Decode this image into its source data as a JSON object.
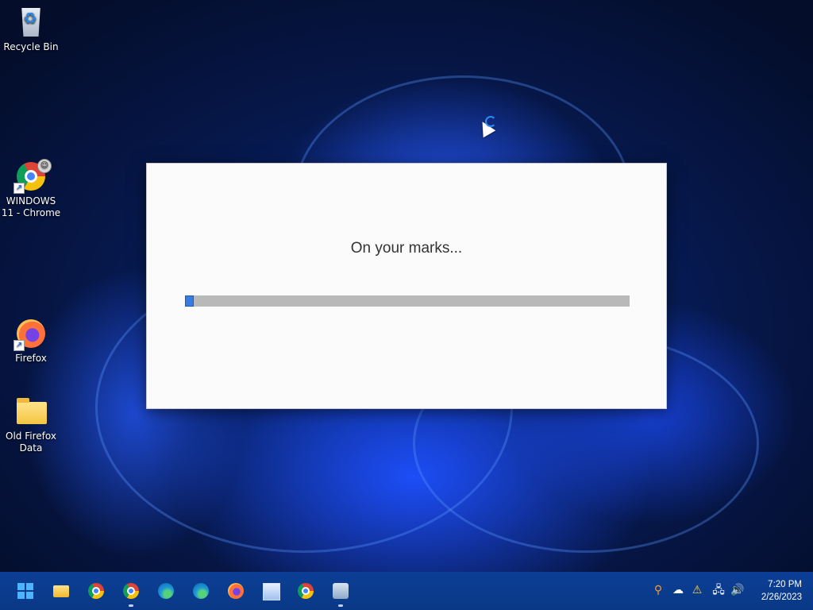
{
  "desktop": {
    "icons": [
      {
        "label": "Recycle Bin",
        "icon": "recycle-bin-icon"
      },
      {
        "label": "WINDOWS 11 - Chrome",
        "icon": "chrome-icon"
      },
      {
        "label": "Firefox",
        "icon": "firefox-icon"
      },
      {
        "label": "Old Firefox Data",
        "icon": "folder-icon"
      }
    ]
  },
  "dialog": {
    "message": "On your marks...",
    "progress_fraction": 0.02
  },
  "taskbar": {
    "apps": [
      {
        "name": "start",
        "icon": "windows-start-icon"
      },
      {
        "name": "file-explorer",
        "icon": "folder-icon"
      },
      {
        "name": "chrome",
        "icon": "chrome-icon"
      },
      {
        "name": "chrome-profile",
        "icon": "chrome-icon",
        "running": true
      },
      {
        "name": "edge",
        "icon": "edge-icon"
      },
      {
        "name": "edge-profile",
        "icon": "edge-icon"
      },
      {
        "name": "firefox",
        "icon": "firefox-icon"
      },
      {
        "name": "resource-monitor",
        "icon": "monitor-icon"
      },
      {
        "name": "chrome-2",
        "icon": "chrome-icon"
      },
      {
        "name": "setup",
        "icon": "setup-icon",
        "running": true
      }
    ],
    "tray": [
      "search-icon",
      "cloud-icon",
      "security-warning-icon",
      "network-icon",
      "volume-icon"
    ],
    "clock": {
      "time": "7:20 PM",
      "date": "2/26/2023"
    }
  },
  "colors": {
    "accent": "#3a7be0",
    "taskbar": "#0a3c8f"
  }
}
